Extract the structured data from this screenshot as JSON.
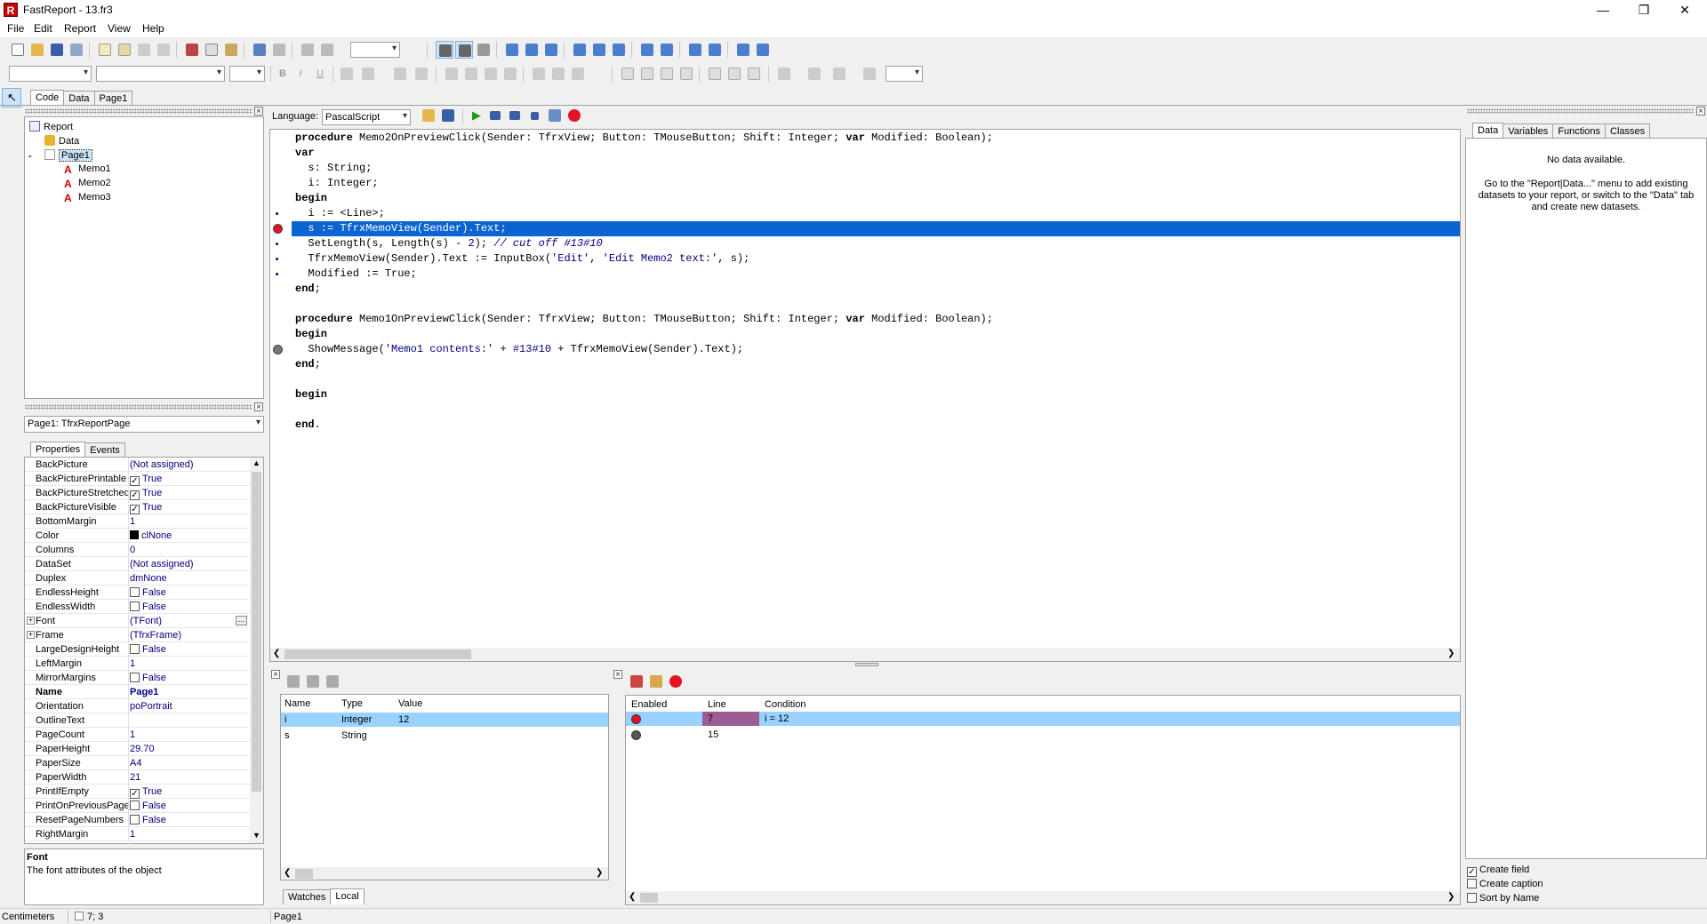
{
  "window": {
    "title": "FastReport - 13.fr3",
    "icon": "fastreport-app-icon",
    "controls": [
      "minimize",
      "maximize",
      "close"
    ]
  },
  "menu": [
    "File",
    "Edit",
    "Report",
    "View",
    "Help"
  ],
  "designer_tabs": [
    "Code",
    "Data",
    "Page1"
  ],
  "report_tree": {
    "nodes": [
      {
        "label": "Report",
        "icon": "report-icon"
      },
      {
        "label": "Data",
        "icon": "database-icon"
      },
      {
        "label": "Page1",
        "icon": "page-icon"
      },
      {
        "label": "Memo1",
        "icon": "memo-text-icon"
      },
      {
        "label": "Memo2",
        "icon": "memo-text-icon"
      },
      {
        "label": "Memo3",
        "icon": "memo-text-icon"
      }
    ]
  },
  "inspector": {
    "object_selector": "Page1: TfrxReportPage",
    "tabs": [
      "Properties",
      "Events"
    ],
    "properties": [
      {
        "name": "BackPicture",
        "value": "(Not assigned)",
        "check": null
      },
      {
        "name": "BackPicturePrintable",
        "value": "True",
        "check": true
      },
      {
        "name": "BackPictureStretched",
        "value": "True",
        "check": true
      },
      {
        "name": "BackPictureVisible",
        "value": "True",
        "check": true
      },
      {
        "name": "BottomMargin",
        "value": "1",
        "check": null
      },
      {
        "name": "Color",
        "value": "clNone",
        "check": null,
        "swatch": "#000000"
      },
      {
        "name": "Columns",
        "value": "0",
        "check": null
      },
      {
        "name": "DataSet",
        "value": "(Not assigned)",
        "check": null
      },
      {
        "name": "Duplex",
        "value": "dmNone",
        "check": null
      },
      {
        "name": "EndlessHeight",
        "value": "False",
        "check": false
      },
      {
        "name": "EndlessWidth",
        "value": "False",
        "check": false
      },
      {
        "name": "Font",
        "value": "(TFont)",
        "check": null,
        "expandable": true
      },
      {
        "name": "Frame",
        "value": "(TfrxFrame)",
        "check": null,
        "expandable": true
      },
      {
        "name": "LargeDesignHeight",
        "value": "False",
        "check": false
      },
      {
        "name": "LeftMargin",
        "value": "1",
        "check": null
      },
      {
        "name": "MirrorMargins",
        "value": "False",
        "check": false
      },
      {
        "name": "Name",
        "value": "Page1",
        "check": null,
        "bold": true
      },
      {
        "name": "Orientation",
        "value": "poPortrait",
        "check": null
      },
      {
        "name": "OutlineText",
        "value": "",
        "check": null
      },
      {
        "name": "PageCount",
        "value": "1",
        "check": null
      },
      {
        "name": "PaperHeight",
        "value": "29.70",
        "check": null
      },
      {
        "name": "PaperSize",
        "value": "A4",
        "check": null
      },
      {
        "name": "PaperWidth",
        "value": "21",
        "check": null
      },
      {
        "name": "PrintIfEmpty",
        "value": "True",
        "check": true
      },
      {
        "name": "PrintOnPreviousPage",
        "value": "False",
        "check": false
      },
      {
        "name": "ResetPageNumbers",
        "value": "False",
        "check": false
      },
      {
        "name": "RightMargin",
        "value": "1",
        "check": null
      }
    ],
    "help_title": "Font",
    "help_text": "The font attributes of the object"
  },
  "code_toolbar": {
    "language_label": "Language:",
    "language_value": "PascalScript"
  },
  "code_lines": [
    [
      {
        "t": "procedure",
        "k": "kw"
      },
      {
        "t": " Memo2OnPreviewClick(Sender: TfrxView; Button: TMouseButton; Shift: Integer; "
      },
      {
        "t": "var",
        "k": "kw"
      },
      {
        "t": " Modified: Boolean);"
      }
    ],
    [
      {
        "t": "var",
        "k": "kw"
      }
    ],
    [
      {
        "t": "  s: String;"
      }
    ],
    [
      {
        "t": "  i: Integer;"
      }
    ],
    [
      {
        "t": "begin",
        "k": "kw"
      }
    ],
    [
      {
        "t": "  i := <Line>;"
      }
    ],
    [
      {
        "t": "  s := TfrxMemoView(Sender).Text;"
      }
    ],
    [
      {
        "t": "  SetLength(s, Length(s) - "
      },
      {
        "t": "2",
        "k": "num"
      },
      {
        "t": "); "
      },
      {
        "t": "// cut off #13#10",
        "k": "cm"
      }
    ],
    [
      {
        "t": "  TfrxMemoView(Sender).Text := InputBox("
      },
      {
        "t": "'Edit'",
        "k": "str"
      },
      {
        "t": ", "
      },
      {
        "t": "'Edit Memo2 text:'",
        "k": "str"
      },
      {
        "t": ", s);"
      }
    ],
    [
      {
        "t": "  Modified := True;"
      }
    ],
    [
      {
        "t": "end",
        "k": "kw"
      },
      {
        "t": ";"
      }
    ],
    [
      {
        "t": ""
      }
    ],
    [
      {
        "t": "procedure",
        "k": "kw"
      },
      {
        "t": " Memo1OnPreviewClick(Sender: TfrxView; Button: TMouseButton; Shift: Integer; "
      },
      {
        "t": "var",
        "k": "kw"
      },
      {
        "t": " Modified: Boolean);"
      }
    ],
    [
      {
        "t": "begin",
        "k": "kw"
      }
    ],
    [
      {
        "t": "  ShowMessage("
      },
      {
        "t": "'Memo1 contents:'",
        "k": "str"
      },
      {
        "t": " + "
      },
      {
        "t": "#13#10",
        "k": "num"
      },
      {
        "t": " + TfrxMemoView(Sender).Text);"
      }
    ],
    [
      {
        "t": "end",
        "k": "kw"
      },
      {
        "t": ";"
      }
    ],
    [
      {
        "t": ""
      }
    ],
    [
      {
        "t": "begin",
        "k": "kw"
      }
    ],
    [
      {
        "t": ""
      }
    ],
    [
      {
        "t": "end",
        "k": "kw"
      },
      {
        "t": "."
      }
    ]
  ],
  "code_highlight_line": 7,
  "code_breakpoints": [
    {
      "line": 7,
      "state": "active"
    },
    {
      "line": 15,
      "state": "disabled"
    }
  ],
  "code_exec_marks": [
    6,
    8,
    9,
    10
  ],
  "watches": {
    "columns": [
      "Name",
      "Type",
      "Value"
    ],
    "rows": [
      {
        "name": "i",
        "type": "Integer",
        "value": "12",
        "selected": true
      },
      {
        "name": "s",
        "type": "String",
        "value": "",
        "selected": false
      }
    ],
    "tabs": [
      "Watches",
      "Local"
    ]
  },
  "breakpoints": {
    "columns": [
      "Enabled",
      "Line",
      "Condition"
    ],
    "rows": [
      {
        "line": "7",
        "condition": "i = 12",
        "enabled": true,
        "selected": true
      },
      {
        "line": "15",
        "condition": "",
        "enabled": false,
        "selected": false
      }
    ]
  },
  "data_tree": {
    "tabs": [
      "Data",
      "Variables",
      "Functions",
      "Classes"
    ],
    "empty_title": "No data available.",
    "empty_hint": "Go to the \"Report|Data...\" menu to add existing datasets to your report, or switch to the \"Data\" tab and create new datasets.",
    "options": [
      {
        "label": "Create field",
        "checked": true
      },
      {
        "label": "Create caption",
        "checked": false
      },
      {
        "label": "Sort by Name",
        "checked": false
      }
    ]
  },
  "status": {
    "units": "Centimeters",
    "position": "7; 3",
    "page": "Page1"
  },
  "colors": {
    "selection": "#0a64d2",
    "row_highlight": "#99d1ff",
    "breakpoint_red": "#e81123",
    "line_cell": "#9b5c92"
  }
}
